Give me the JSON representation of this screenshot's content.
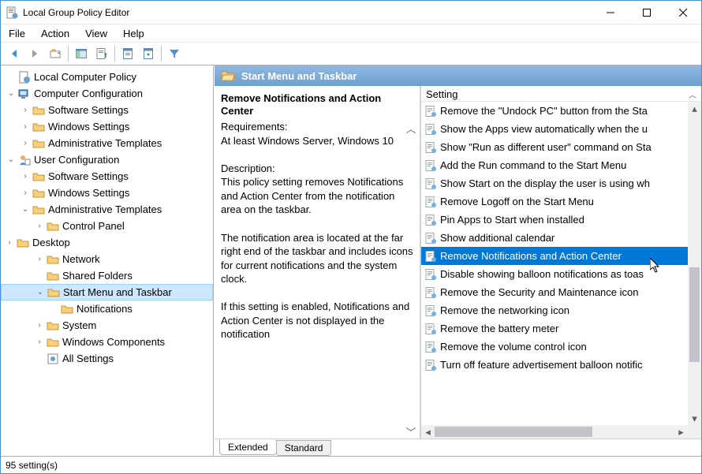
{
  "window": {
    "title": "Local Group Policy Editor"
  },
  "menu": {
    "file": "File",
    "action": "Action",
    "view": "View",
    "help": "Help"
  },
  "tree": {
    "root": "Local Computer Policy",
    "cc": "Computer Configuration",
    "cc_soft": "Software Settings",
    "cc_win": "Windows Settings",
    "cc_admin": "Administrative Templates",
    "uc": "User Configuration",
    "uc_soft": "Software Settings",
    "uc_win": "Windows Settings",
    "uc_admin": "Administrative Templates",
    "cp": "Control Panel",
    "desktop": "Desktop",
    "network": "Network",
    "shared": "Shared Folders",
    "startmenu": "Start Menu and Taskbar",
    "notif": "Notifications",
    "system": "System",
    "wincomp": "Windows Components",
    "allset": "All Settings"
  },
  "header": {
    "title": "Start Menu and Taskbar"
  },
  "desc": {
    "title": "Remove Notifications and Action Center",
    "req_label": "Requirements:",
    "req_text": "At least Windows Server, Windows 10",
    "desc_label": "Description:",
    "p1": "This policy setting removes Notifications and Action Center from the notification area on the taskbar.",
    "p2": "The notification area is located at the far right end of the taskbar and includes icons for current notifications and the system clock.",
    "p3": "If this setting is enabled, Notifications and Action Center is not displayed in the notification"
  },
  "settings_header": "Setting",
  "settings": [
    "Remove the \"Undock PC\" button from the Sta",
    "Show the Apps view automatically when the u",
    "Show \"Run as different user\" command on Sta",
    "Add the Run command to the Start Menu",
    "Show Start on the display the user is using wh",
    "Remove Logoff on the Start Menu",
    "Pin Apps to Start when installed",
    "Show additional calendar",
    "Remove Notifications and Action Center",
    "Disable showing balloon notifications as toas",
    "Remove the Security and Maintenance icon",
    "Remove the networking icon",
    "Remove the battery meter",
    "Remove the volume control icon",
    "Turn off feature advertisement balloon notific"
  ],
  "selected_setting_index": 8,
  "tabs": {
    "extended": "Extended",
    "standard": "Standard"
  },
  "status": "95 setting(s)"
}
